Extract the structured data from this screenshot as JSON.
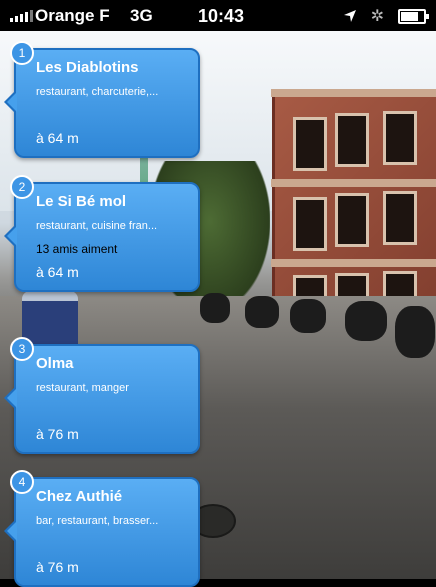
{
  "status_bar": {
    "carrier": "Orange F",
    "network": "3G",
    "time": "10:43",
    "battery_level": 0.85
  },
  "places": [
    {
      "number": "1",
      "name": "Les Diablotins",
      "categories": "restaurant, charcuterie,...",
      "friends": "",
      "distance": "à 64 m"
    },
    {
      "number": "2",
      "name": "Le Si Bé mol",
      "categories": "restaurant, cuisine fran...",
      "friends": "13 amis aiment",
      "distance": "à 64 m"
    },
    {
      "number": "3",
      "name": "Olma",
      "categories": "restaurant, manger",
      "friends": "",
      "distance": "à 76 m"
    },
    {
      "number": "4",
      "name": "Chez Authié",
      "categories": "bar, restaurant, brasser...",
      "friends": "",
      "distance": "à 76 m"
    }
  ],
  "colors": {
    "bubble": "#3d95e5",
    "status_bar": "#000000"
  },
  "icons": [
    "signal-bars-icon",
    "location-arrow-icon",
    "bluetooth-icon",
    "battery-icon"
  ]
}
